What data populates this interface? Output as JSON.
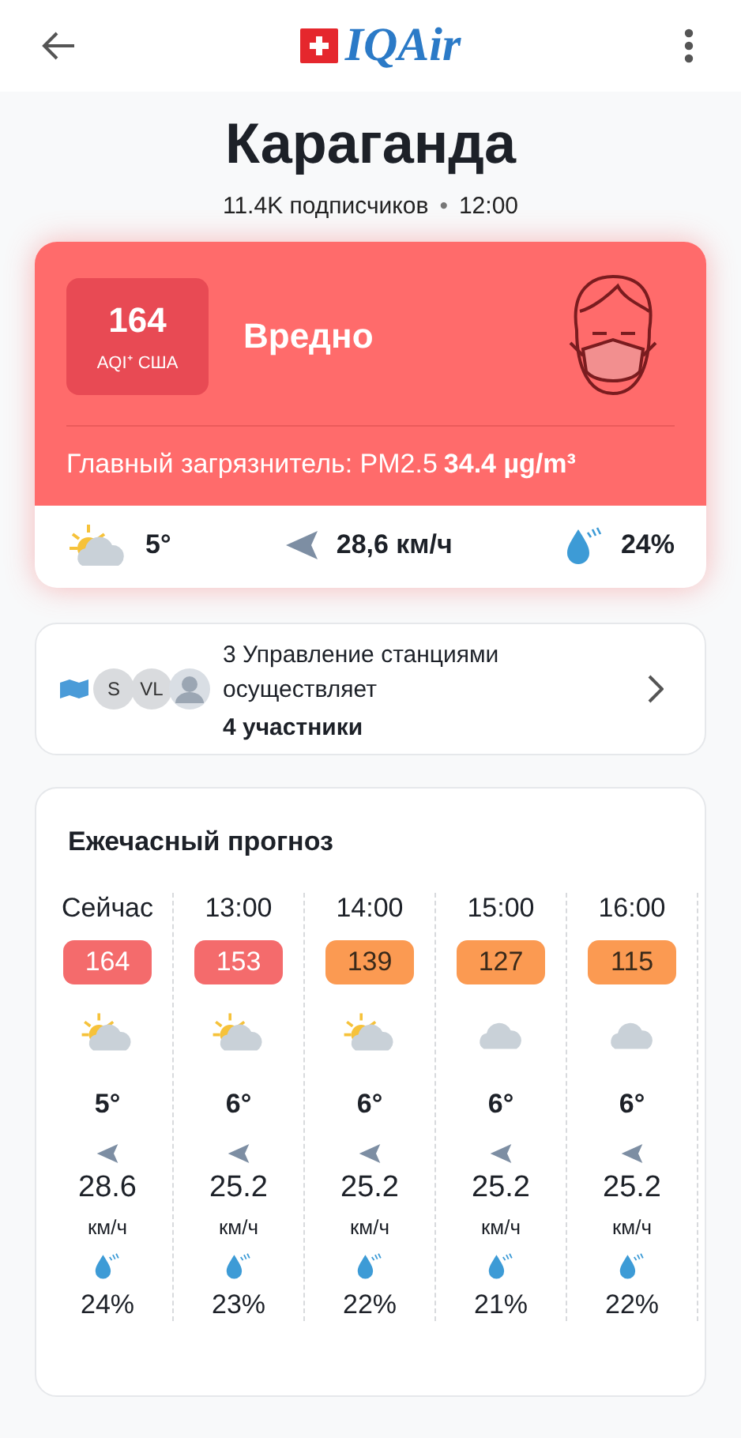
{
  "header": {
    "logo": "IQAir"
  },
  "city": {
    "name": "Караганда",
    "followers": "11.4K подписчиков",
    "separator": "•",
    "time": "12:00"
  },
  "aqi_card": {
    "value": "164",
    "unit": "AQI⁺ США",
    "status": "Вредно",
    "pollutant_label": "Главный загрязнитель: PM2.5",
    "pollutant_value": "34.4 µg/m³",
    "weather": {
      "kind": "sun_cloud",
      "temp": "5°",
      "wind": "28,6 км/ч",
      "humidity": "24%"
    }
  },
  "stations": {
    "avatars": [
      {
        "kind": "map"
      },
      {
        "kind": "initials",
        "text": "S"
      },
      {
        "kind": "initials",
        "text": "VL"
      },
      {
        "kind": "person"
      }
    ],
    "line1": "3 Управление станциями осуществляет",
    "line2": "4 участники"
  },
  "forecast": {
    "title": "Ежечасный прогноз",
    "hours": [
      {
        "time": "Сейчас",
        "aqi": "164",
        "color": "#f46b6c",
        "kind": "sun_cloud",
        "temp": "5°",
        "wind": "28.6",
        "wind_unit": "км/ч",
        "humidity": "24%"
      },
      {
        "time": "13:00",
        "aqi": "153",
        "color": "#f46b6c",
        "kind": "sun_cloud",
        "temp": "6°",
        "wind": "25.2",
        "wind_unit": "км/ч",
        "humidity": "23%"
      },
      {
        "time": "14:00",
        "aqi": "139",
        "color": "#fb9a52",
        "kind": "sun_cloud",
        "temp": "6°",
        "wind": "25.2",
        "wind_unit": "км/ч",
        "humidity": "22%"
      },
      {
        "time": "15:00",
        "aqi": "127",
        "color": "#fb9a52",
        "kind": "cloud",
        "temp": "6°",
        "wind": "25.2",
        "wind_unit": "км/ч",
        "humidity": "21%"
      },
      {
        "time": "16:00",
        "aqi": "115",
        "color": "#fb9a52",
        "kind": "cloud",
        "temp": "6°",
        "wind": "25.2",
        "wind_unit": "км/ч",
        "humidity": "22%"
      }
    ]
  }
}
